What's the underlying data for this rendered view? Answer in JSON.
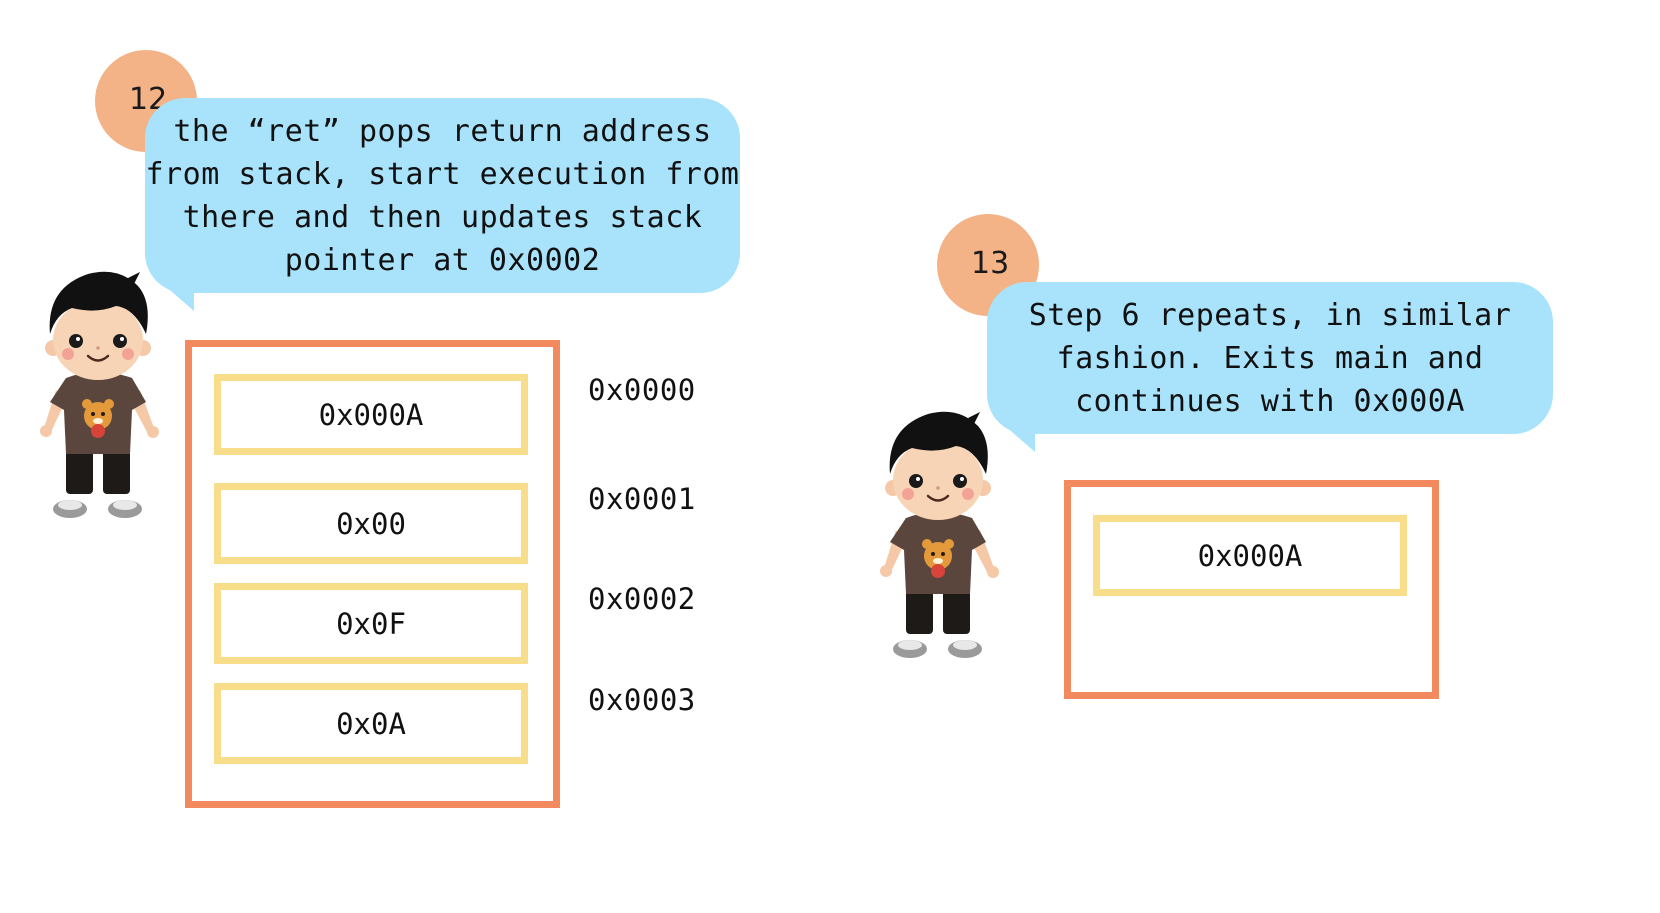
{
  "left_panel": {
    "step_number": "12",
    "bubble_text": [
      "the “ret” pops return address",
      "from stack, start execution from",
      "there and then updates stack",
      "pointer at 0x0002"
    ],
    "stack_cells": [
      "0x000A",
      "0x00",
      "0x0F",
      "0x0A"
    ],
    "addresses": [
      "0x0000",
      "0x0001",
      "0x0002",
      "0x0003"
    ]
  },
  "right_panel": {
    "step_number": "13",
    "bubble_text": [
      "Step 6 repeats, in similar",
      "fashion. Exits main and",
      "continues with 0x000A"
    ],
    "stack_cells": [
      "0x000A"
    ]
  },
  "colors": {
    "step_circle": "#f4b287",
    "bubble": "#a9e3fb",
    "stack_frame": "#f2895f",
    "stack_cell": "#f8de8a"
  },
  "icons": {
    "character": "cartoon-boy-with-bear-shirt"
  }
}
